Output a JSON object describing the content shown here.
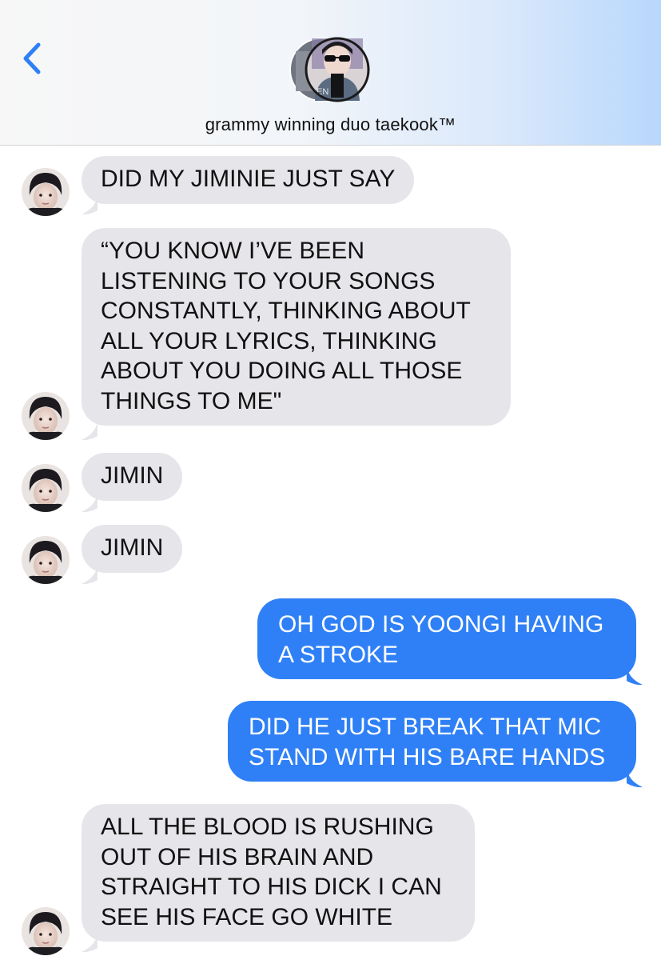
{
  "header": {
    "contact_name": "grammy winning duo taekook™",
    "back_icon": "chevron-left-icon"
  },
  "colors": {
    "incoming_bubble": "#e5e5ea",
    "outgoing_bubble": "#2f80f6",
    "accent": "#2f80f6"
  },
  "messages": [
    {
      "direction": "incoming",
      "text": "DID MY JIMINIE JUST SAY"
    },
    {
      "direction": "incoming",
      "text": "“YOU KNOW I’VE BEEN\nLISTENING TO YOUR SONGS\nCONSTANTLY, THINKING ABOUT\nALL YOUR LYRICS, THINKING\nABOUT YOU DOING ALL THOSE\nTHINGS TO ME\""
    },
    {
      "direction": "incoming",
      "text": "JIMIN"
    },
    {
      "direction": "incoming",
      "text": "JIMIN"
    },
    {
      "direction": "outgoing",
      "text": "OH GOD IS YOONGI HAVING\nA STROKE"
    },
    {
      "direction": "outgoing",
      "text": "DID HE JUST BREAK THAT MIC\nSTAND WITH HIS BARE HANDS"
    },
    {
      "direction": "incoming",
      "text": "ALL THE BLOOD IS RUSHING\nOUT OF HIS BRAIN AND\nSTRAIGHT TO HIS DICK I CAN\nSEE HIS FACE GO WHITE"
    }
  ]
}
